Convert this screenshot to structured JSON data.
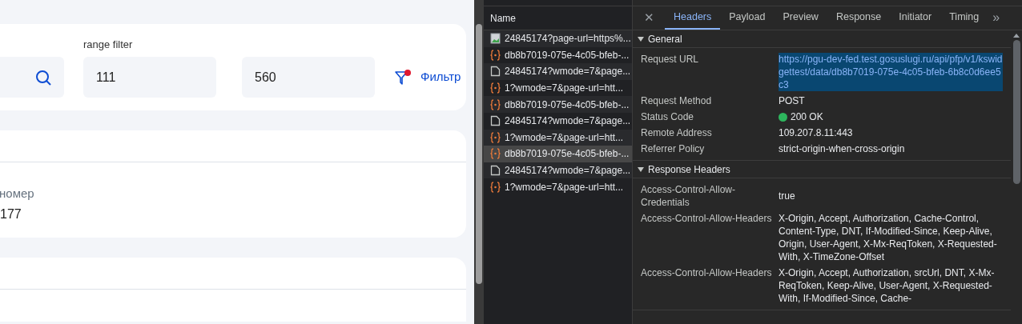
{
  "page": {
    "range_filter": {
      "label": "range filter",
      "from": "111",
      "to": "560"
    },
    "filters_button": {
      "label": "Фильтр",
      "active": true
    },
    "cards": [
      {
        "field_label": "номер",
        "field_value": "177"
      }
    ]
  },
  "devtools": {
    "name_header": "Name",
    "requests": [
      {
        "kind": "image",
        "name": "24845174?page-url=https%...",
        "selected": false
      },
      {
        "kind": "fetch",
        "name": "db8b7019-075e-4c05-bfeb-...",
        "selected": false
      },
      {
        "kind": "document",
        "name": "24845174?wmode=7&page...",
        "selected": false
      },
      {
        "kind": "fetch",
        "name": "1?wmode=7&page-url=htt...",
        "selected": false
      },
      {
        "kind": "fetch",
        "name": "db8b7019-075e-4c05-bfeb-...",
        "selected": false
      },
      {
        "kind": "document",
        "name": "24845174?wmode=7&page...",
        "selected": false
      },
      {
        "kind": "fetch",
        "name": "1?wmode=7&page-url=htt...",
        "selected": false
      },
      {
        "kind": "fetch",
        "name": "db8b7019-075e-4c05-bfeb-...",
        "selected": true
      },
      {
        "kind": "document",
        "name": "24845174?wmode=7&page...",
        "selected": false
      },
      {
        "kind": "fetch",
        "name": "1?wmode=7&page-url=htt...",
        "selected": false
      }
    ],
    "close": "✕",
    "tabs": [
      {
        "label": "Headers",
        "selected": true
      },
      {
        "label": "Payload",
        "selected": false
      },
      {
        "label": "Preview",
        "selected": false
      },
      {
        "label": "Response",
        "selected": false
      },
      {
        "label": "Initiator",
        "selected": false
      },
      {
        "label": "Timing",
        "selected": false
      }
    ],
    "more_tabs": "»",
    "sections": [
      {
        "title": "General",
        "expanded": true,
        "rows": [
          {
            "key": "Request URL",
            "value": "https://pgu-dev-fed.test.gosuslugi.ru/api/pfp/v1/kswidgettest/data/db8b7019-075e-4c05-bfeb-6b8c0d6ee5c3",
            "highlighted": true
          },
          {
            "key": "Request Method",
            "value": "POST"
          },
          {
            "key": "Status Code",
            "value": "200 OK",
            "color": "#2db55d"
          },
          {
            "key": "Remote Address",
            "value": "109.207.8.11:443"
          },
          {
            "key": "Referrer Policy",
            "value": "strict-origin-when-cross-origin"
          }
        ]
      },
      {
        "title": "Response Headers",
        "expanded": true,
        "rows": [
          {
            "key": "Access-Control-Allow-Credentials",
            "value": "true"
          },
          {
            "key": "Access-Control-Allow-Headers",
            "value": "X-Origin, Accept, Authorization, Cache-Control, Content-Type, DNT, If-Modified-Since, Keep-Alive, Origin, User-Agent, X-Mx-ReqToken, X-Requested-With, X-TimeZone-Offset"
          },
          {
            "key": "Access-Control-Allow-Headers",
            "value": "X-Origin, Accept, Authorization, srcUrl, DNT, X-Mx-ReqToken, Keep-Alive, User-Agent, X-Requested-With, If-Modified-Since, Cache-"
          }
        ]
      }
    ]
  }
}
